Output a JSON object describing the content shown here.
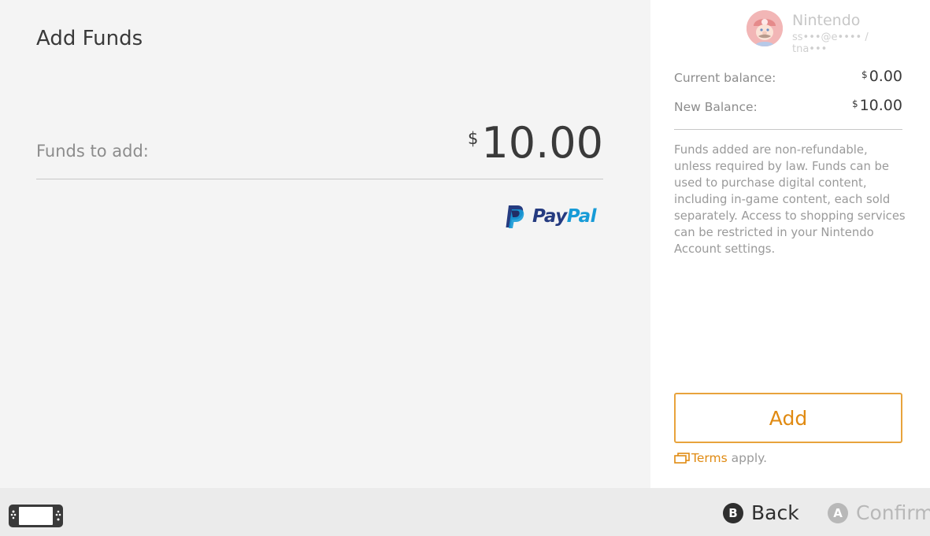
{
  "page": {
    "title": "Add Funds"
  },
  "funds": {
    "label": "Funds to add:",
    "currency_symbol": "$",
    "amount": "10.00"
  },
  "payment": {
    "brand_pay": "Pay",
    "brand_pal": "Pal",
    "icon": "paypal-logo"
  },
  "account": {
    "name": "Nintendo",
    "id": "ss•••@e•••• / tna•••"
  },
  "balance": {
    "current_label": "Current balance:",
    "current_currency": "$",
    "current_value": "0.00",
    "new_label": "New Balance:",
    "new_currency": "$",
    "new_value": "10.00"
  },
  "notice": "Funds added are non-refundable, unless required by law. Funds can be used to purchase digital content, including in-game content, each sold separately. Access to shopping services can be restricted in your Nintendo Account settings.",
  "actions": {
    "add_label": "Add",
    "terms_link": "Terms",
    "terms_suffix": "apply."
  },
  "footer": {
    "back_glyph": "B",
    "back_label": "Back",
    "confirm_glyph": "A",
    "confirm_label": "Confirm"
  },
  "colors": {
    "accent": "#e08a12",
    "button_border": "#e8a33c",
    "paypal_dark": "#253b80",
    "paypal_light": "#179bd7"
  }
}
